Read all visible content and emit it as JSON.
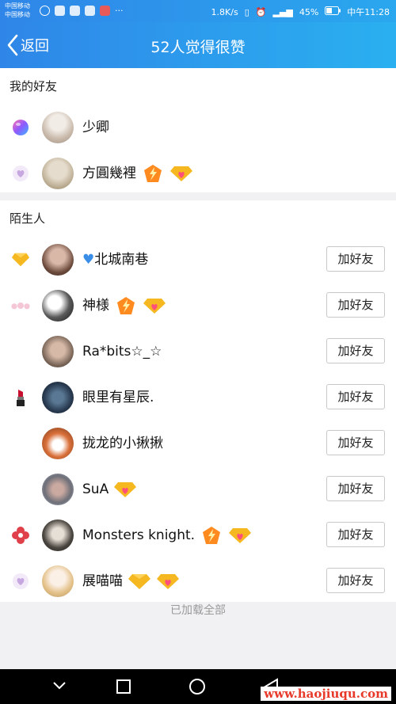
{
  "status": {
    "carrier_top": "中国移动",
    "carrier_bottom": "中国移动",
    "speed": "1.8K/s",
    "battery": "45%",
    "time": "中午11:28"
  },
  "nav": {
    "back_label": "返回",
    "title": "52人觉得很赞"
  },
  "friends": {
    "header": "我的好友",
    "rows": [
      {
        "name": "少卿"
      },
      {
        "name": "方圓幾裡"
      }
    ]
  },
  "strangers": {
    "header": "陌生人",
    "add_label": "加好友",
    "rows": [
      {
        "name": "北城南巷"
      },
      {
        "name": "神様"
      },
      {
        "name": "Ra*bits☆_☆"
      },
      {
        "name": "眼里有星辰."
      },
      {
        "name": "拢龙的小揪揪"
      },
      {
        "name": "SuA"
      },
      {
        "name": "Monsters knight."
      },
      {
        "name": "展喵喵"
      }
    ]
  },
  "footer": {
    "loaded_all": "已加载全部"
  },
  "watermark": "www.haojiuqu.com",
  "colors": {
    "nav_gradient_start": "#2f86e8",
    "nav_gradient_end": "#2ab0f0",
    "diamond": "#f5b820",
    "heart": "#ff4f7a"
  }
}
